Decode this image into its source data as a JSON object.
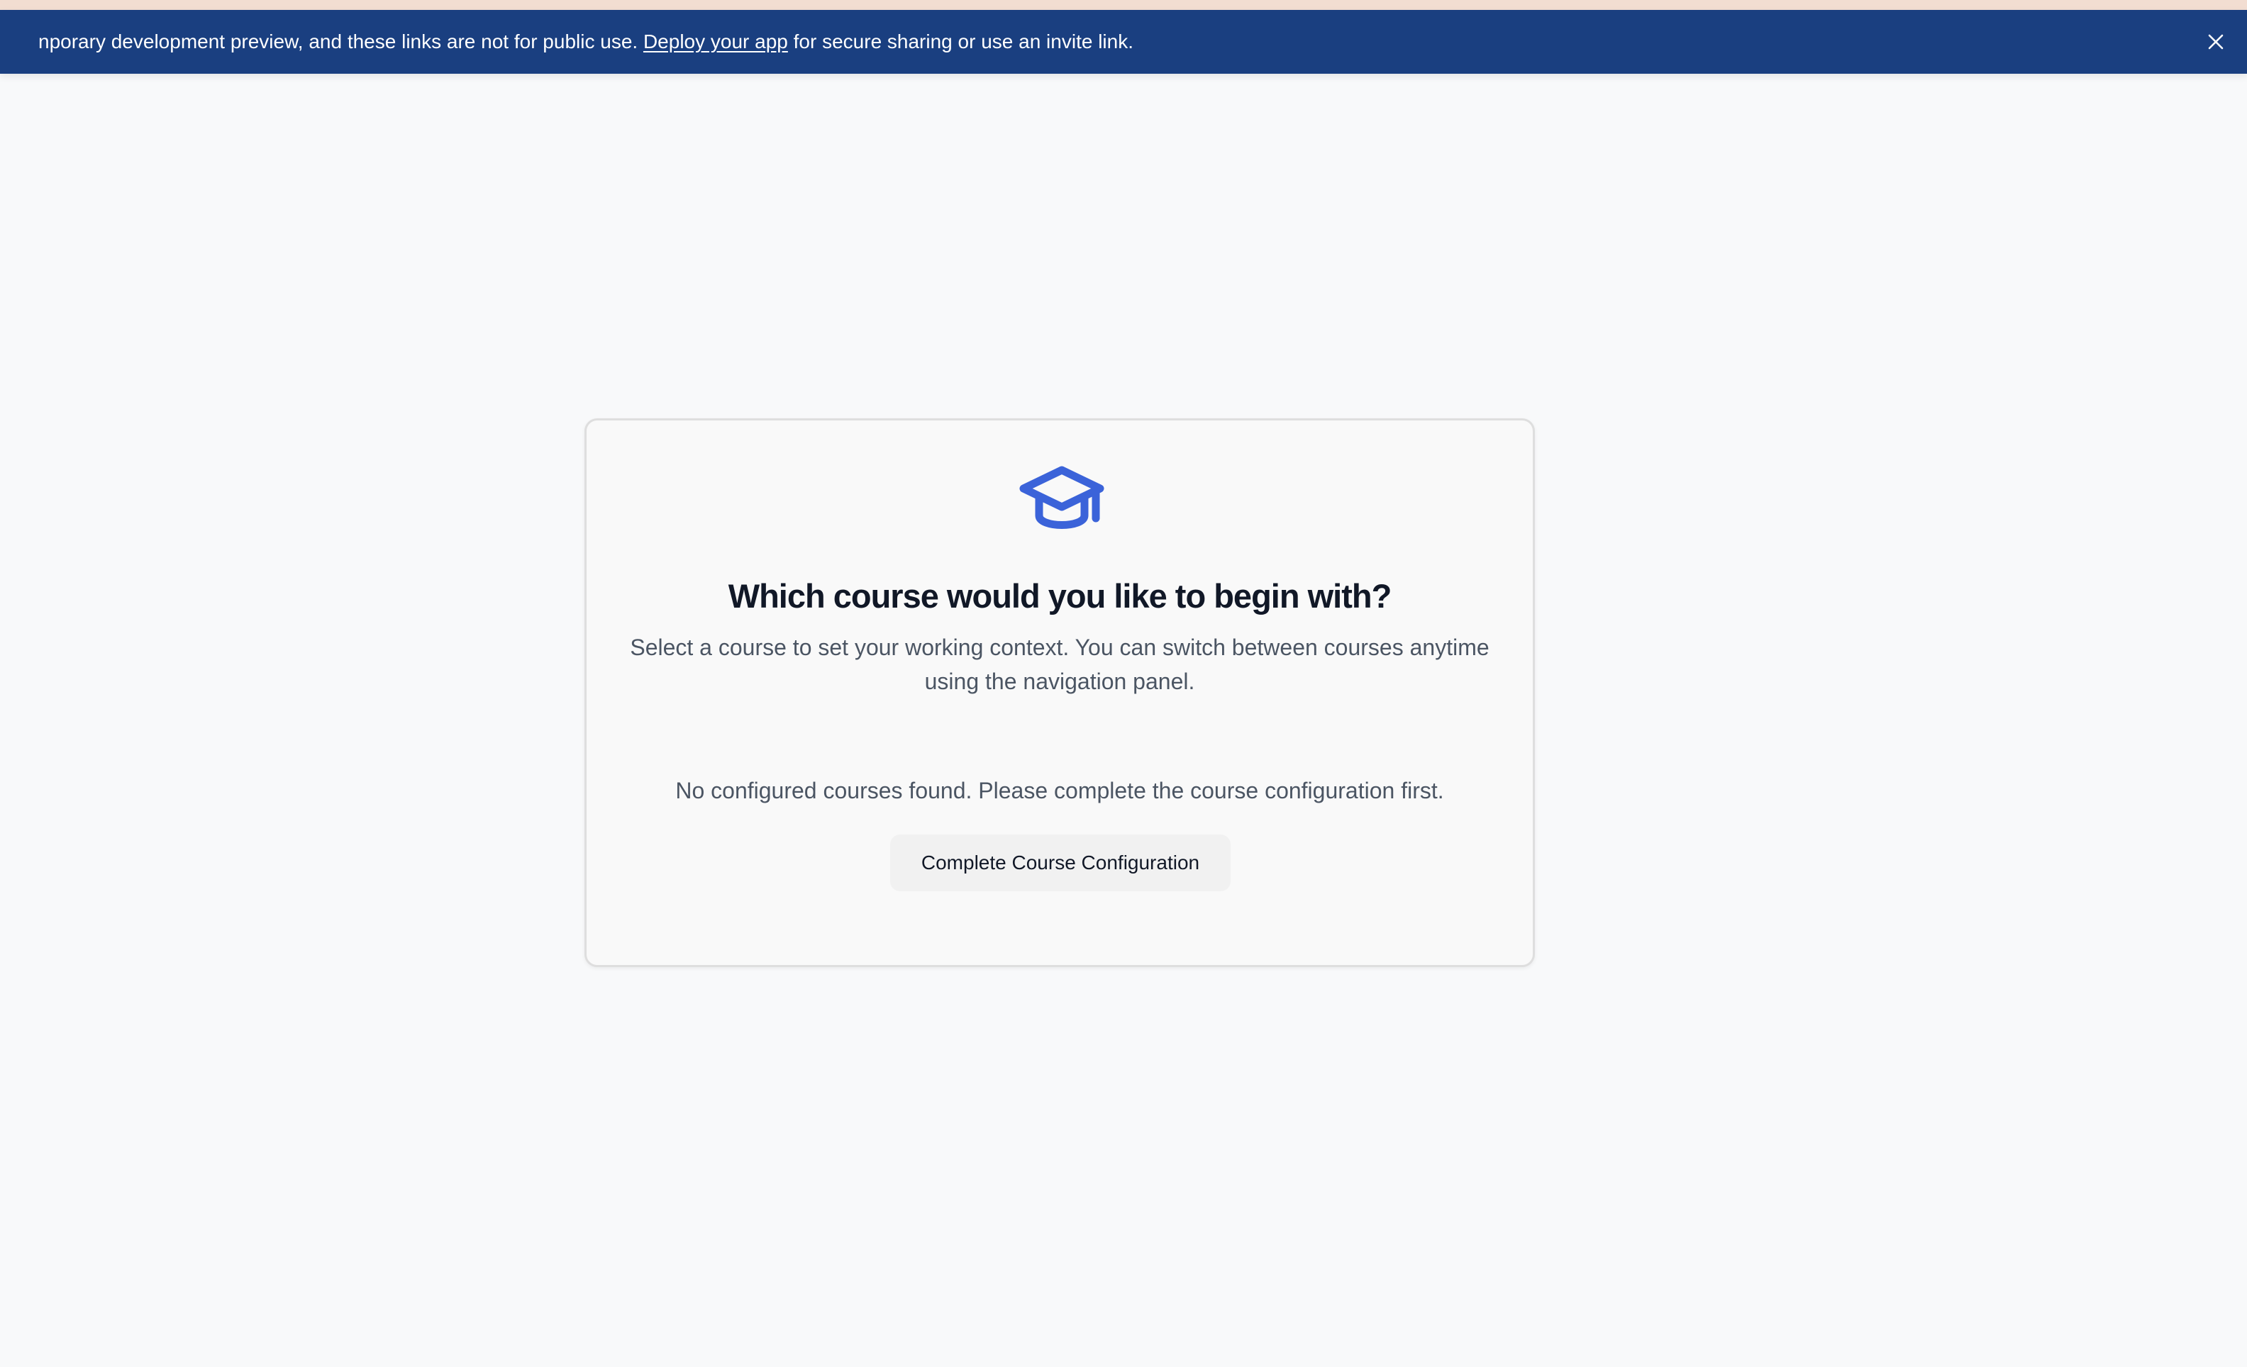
{
  "banner": {
    "text_before": "nporary development preview, and these links are not for public use. ",
    "link_text": "Deploy your app",
    "text_after": " for secure sharing or use an invite link.",
    "close_icon": "close-icon"
  },
  "card": {
    "icon": "graduation-cap-icon",
    "title": "Which course would you like to begin with?",
    "subtitle": "Select a course to set your working context. You can switch between courses anytime using the navigation panel.",
    "empty_message": "No configured courses found. Please complete the course configuration first.",
    "button_label": "Complete Course Configuration"
  },
  "colors": {
    "banner_background": "#1a3f80",
    "accent": "#3b63d9",
    "page_background": "#f8f9fa",
    "title_text": "#111827",
    "body_text": "#4b5563"
  }
}
